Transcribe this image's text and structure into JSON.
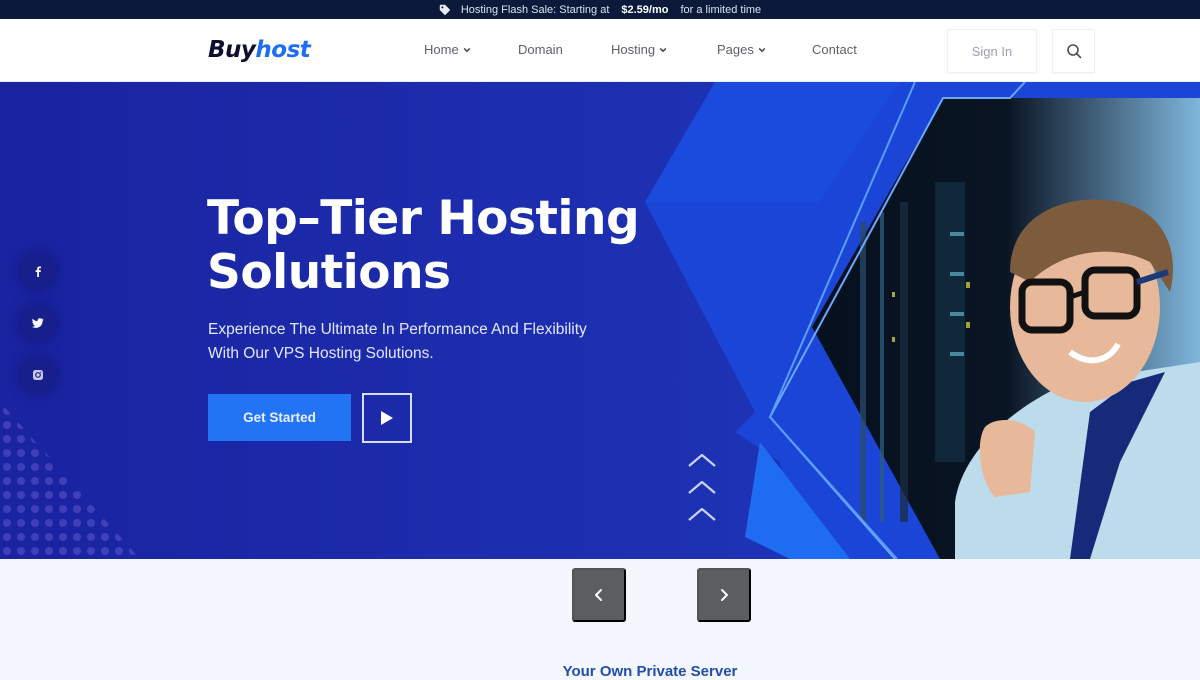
{
  "promo": {
    "icon": "tag-icon",
    "text_before": "Hosting Flash Sale: Starting at",
    "price": "$2.59/mo",
    "text_after": "for a limited time"
  },
  "header": {
    "logo_part1": "Buy",
    "logo_part2": "host",
    "nav": [
      {
        "label": "Home",
        "has_dropdown": true
      },
      {
        "label": "Domain",
        "has_dropdown": false
      },
      {
        "label": "Hosting",
        "has_dropdown": true
      },
      {
        "label": "Pages",
        "has_dropdown": true
      },
      {
        "label": "Contact",
        "has_dropdown": false
      }
    ],
    "signin_label": "Sign In",
    "search_icon": "search-icon"
  },
  "hero": {
    "title_line1": "Top–Tier Hosting",
    "title_line2": "Solutions",
    "subtitle_line1": "Experience The Ultimate In Performance And Flexibility",
    "subtitle_line2": "With Our VPS Hosting Solutions.",
    "cta_label": "Get Started",
    "play_icon": "play-icon",
    "social": [
      "facebook-icon",
      "twitter-icon",
      "instagram-icon"
    ],
    "image_alt": "Smiling man with glasses in front of server racks"
  },
  "carousel": {
    "prev_icon": "chevron-left-icon",
    "next_icon": "chevron-right-icon"
  },
  "section": {
    "title": "Your Own Private Server"
  },
  "colors": {
    "promo_bg": "#0b1a3a",
    "brand_dark": "#0d0f2e",
    "brand_blue": "#1d6ef0",
    "hero_bg": "#1a2aa8",
    "cta_bg": "#2374f5",
    "arrow_bg": "#5b5d60",
    "section_title": "#1f4fa8"
  }
}
